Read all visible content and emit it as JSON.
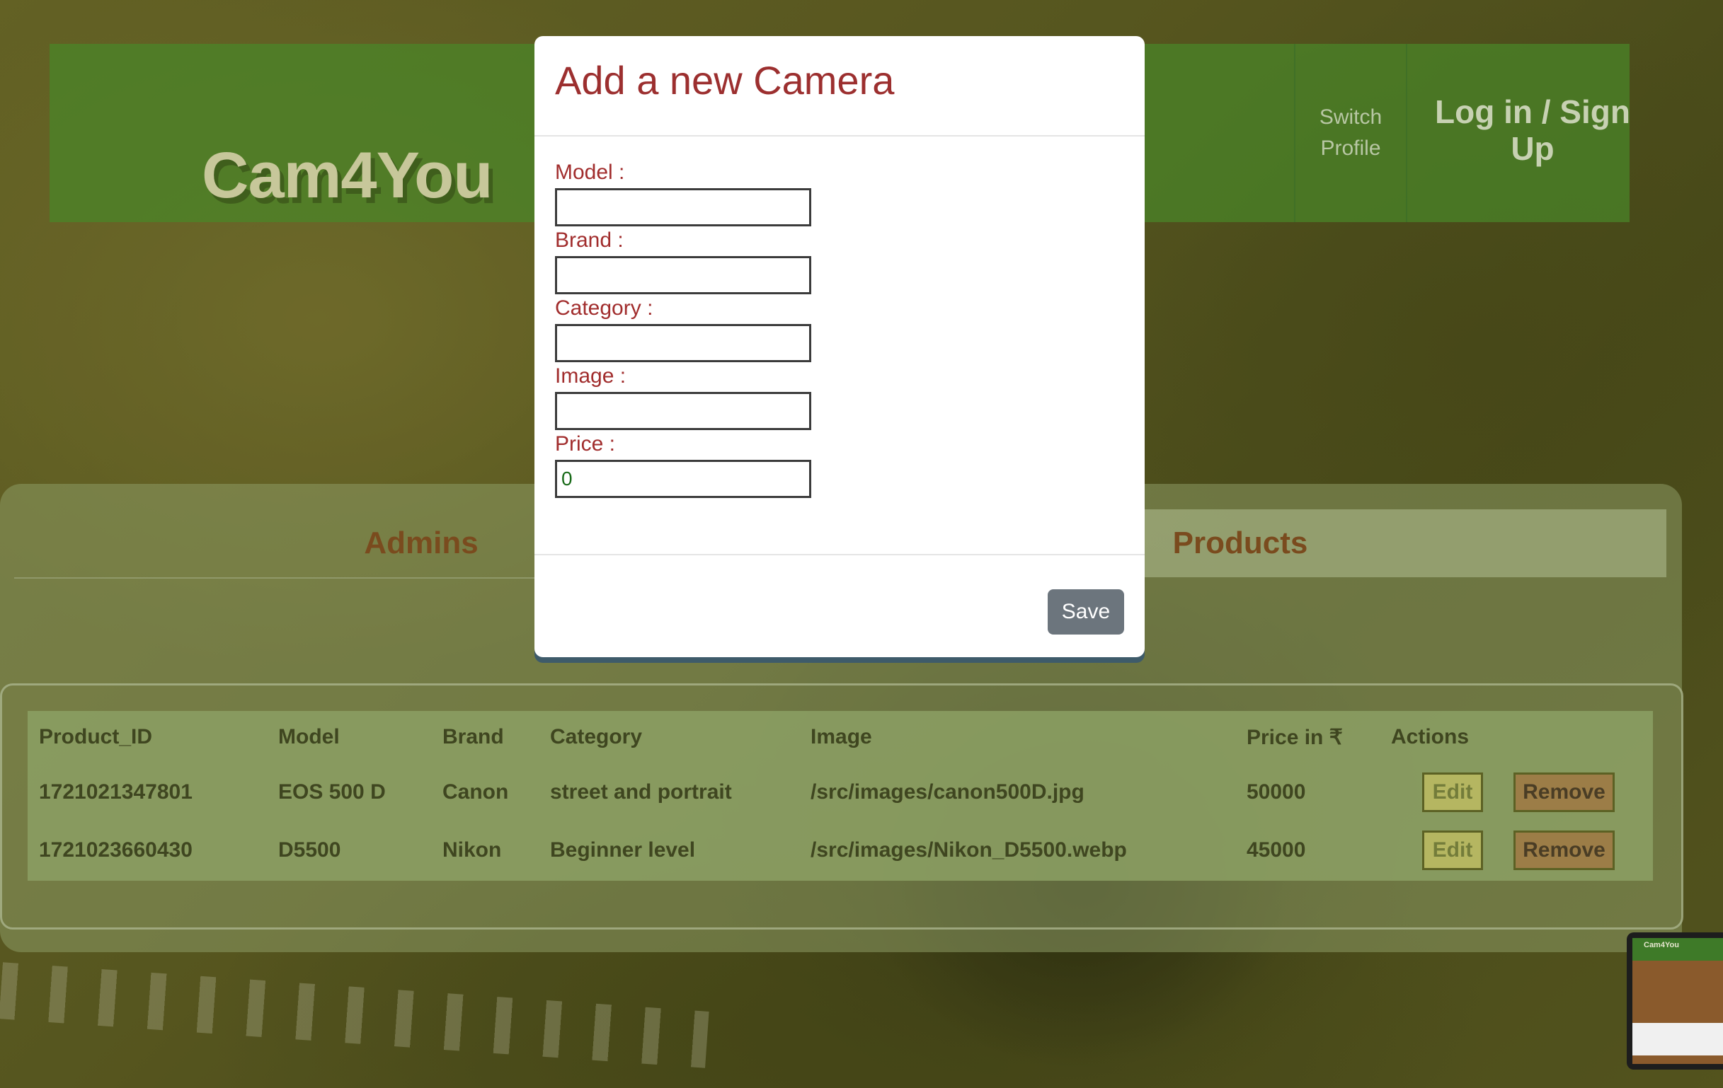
{
  "header": {
    "brand": "Cam4You",
    "switch_profile": "Switch Profile",
    "login": "Log in / Sign Up"
  },
  "tabs": {
    "admins": "Admins",
    "products": "Products"
  },
  "table": {
    "columns": [
      "Product_ID",
      "Model",
      "Brand",
      "Category",
      "Image",
      "Price in ₹",
      "Actions"
    ],
    "rows": [
      {
        "product_id": "1721021347801",
        "model": "EOS 500 D",
        "brand": "Canon",
        "category": "street and portrait",
        "image": "/src/images/canon500D.jpg",
        "price": "50000"
      },
      {
        "product_id": "1721023660430",
        "model": "D5500",
        "brand": "Nikon",
        "category": "Beginner level",
        "image": "/src/images/Nikon_D5500.webp",
        "price": "45000"
      }
    ],
    "edit_label": "Edit",
    "remove_label": "Remove"
  },
  "modal": {
    "title": "Add a new Camera",
    "fields": {
      "model": {
        "label": "Model :",
        "value": ""
      },
      "brand": {
        "label": "Brand :",
        "value": ""
      },
      "category": {
        "label": "Category :",
        "value": ""
      },
      "image": {
        "label": "Image :",
        "value": ""
      },
      "price": {
        "label": "Price :",
        "value": "0"
      }
    },
    "save_label": "Save"
  },
  "thumbnail": {
    "brand": "Cam4You"
  }
}
